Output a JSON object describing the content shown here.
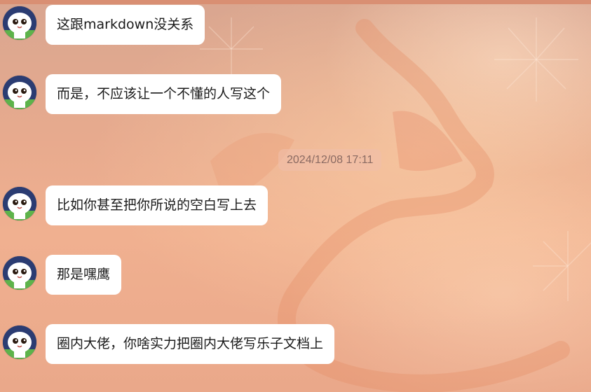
{
  "chat": {
    "timestamp": "2024/12/08 17:11",
    "messages": [
      {
        "text": "这跟markdown没关系",
        "avatar": "cat-avatar"
      },
      {
        "text": "而是，不应该让一个不懂的人写这个",
        "avatar": "cat-avatar"
      },
      {
        "text": "比如你甚至把你所说的空白写上去",
        "avatar": "cat-avatar"
      },
      {
        "text": "那是嘿鹰",
        "avatar": "cat-avatar"
      },
      {
        "text": "圈内大佬，你啥实力把圈内大佬写乐子文档上",
        "avatar": "cat-avatar"
      }
    ]
  },
  "colors": {
    "bubble": "#ffffff",
    "text": "#1a1a1a",
    "timestamp_text": "#8a6a62"
  }
}
